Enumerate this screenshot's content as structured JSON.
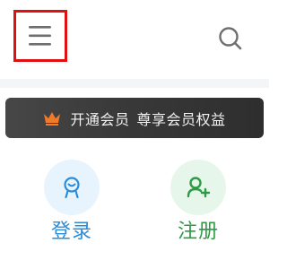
{
  "header": {
    "menu_icon": "hamburger-menu-icon",
    "search_icon": "search-icon"
  },
  "vip_banner": {
    "icon": "crown-icon",
    "text_part1": "开通会员",
    "text_part2": "尊享会员权益"
  },
  "actions": {
    "login": {
      "label": "登录",
      "icon": "user-badge-icon",
      "color": "#2b8cd9"
    },
    "register": {
      "label": "注册",
      "icon": "add-user-icon",
      "color": "#2d9a45"
    }
  },
  "colors": {
    "highlight_border": "#e01010",
    "crown": "#f07a2a",
    "banner_bg": "#3a3a3a",
    "icon_gray": "#6f6f6f"
  }
}
